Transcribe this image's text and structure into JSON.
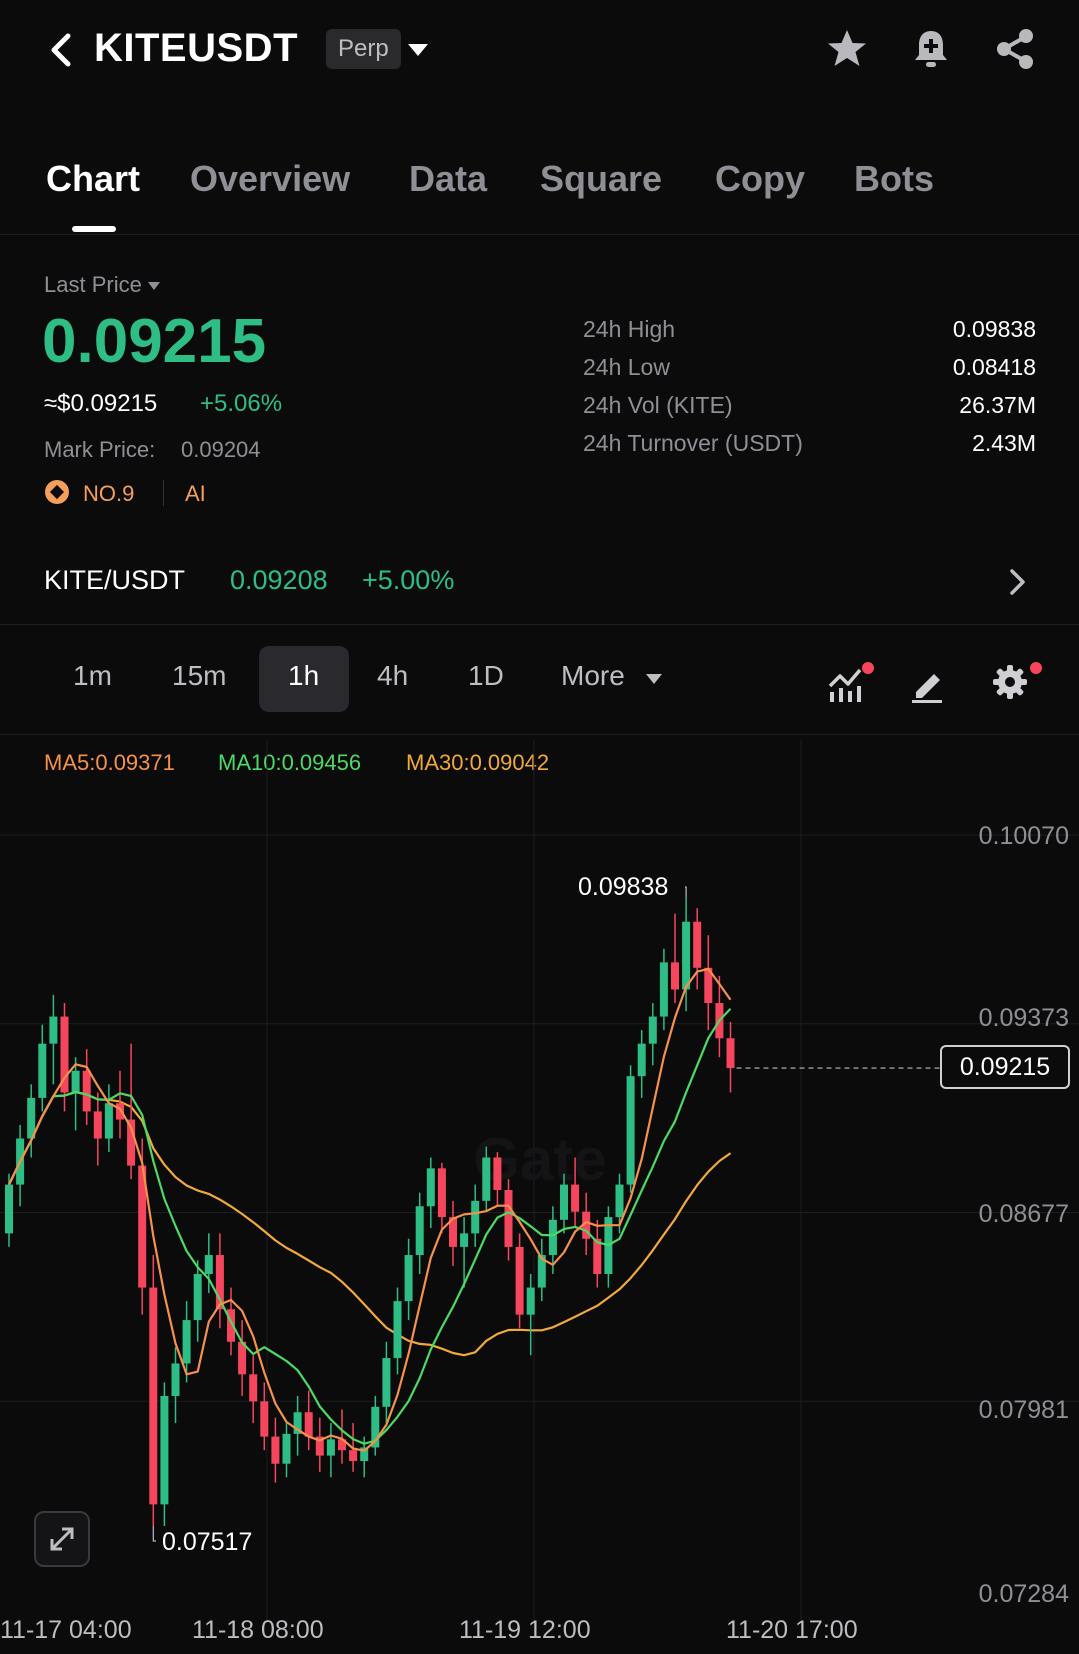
{
  "header": {
    "symbol": "KITEUSDT",
    "contract_type": "Perp",
    "icons": [
      "back-icon",
      "dropdown-icon",
      "star-icon",
      "bell-plus-icon",
      "share-icon"
    ]
  },
  "tabs": [
    "Chart",
    "Overview",
    "Data",
    "Square",
    "Copy",
    "Bots"
  ],
  "active_tab": "Chart",
  "price": {
    "label": "Last Price",
    "last": "0.09215",
    "usd_equiv": "≈$0.09215",
    "change_pct": "+5.06%",
    "mark_label": "Mark Price:",
    "mark_value": "0.09204",
    "rank": "NO.9",
    "tag": "AI"
  },
  "stats": [
    {
      "label": "24h High",
      "value": "0.09838"
    },
    {
      "label": "24h Low",
      "value": "0.08418"
    },
    {
      "label": "24h Vol (KITE)",
      "value": "26.37M"
    },
    {
      "label": "24h Turnover (USDT)",
      "value": "2.43M"
    }
  ],
  "spot": {
    "pair": "KITE/USDT",
    "price": "0.09208",
    "change": "+5.00%"
  },
  "intervals": [
    "1m",
    "15m",
    "1h",
    "4h",
    "1D",
    "More"
  ],
  "active_interval": "1h",
  "ma_legend": {
    "ma5": "MA5:0.09371",
    "ma10": "MA10:0.09456",
    "ma30": "MA30:0.09042"
  },
  "colors": {
    "up": "#2ebd85",
    "down": "#f6465d",
    "ma5": "#f5914a",
    "ma10": "#4cd964",
    "ma30": "#f2a93b"
  },
  "chart_data": {
    "type": "candlestick",
    "y_ticks": [
      "0.10070",
      "0.09373",
      "0.08677",
      "0.07981",
      "0.07284"
    ],
    "ylim": [
      0.07284,
      0.1007
    ],
    "x_ticks": [
      "11-17 04:00",
      "11-18 08:00",
      "11-19 12:00",
      "11-20 17:00"
    ],
    "high_label": "0.09838",
    "low_label": "0.07517",
    "current_price": "0.09215",
    "candles": [
      [
        0.086,
        0.0882,
        0.0855,
        0.0878
      ],
      [
        0.0878,
        0.09,
        0.087,
        0.0895
      ],
      [
        0.0895,
        0.0915,
        0.0888,
        0.091
      ],
      [
        0.091,
        0.0937,
        0.0905,
        0.093
      ],
      [
        0.093,
        0.0948,
        0.0915,
        0.094
      ],
      [
        0.094,
        0.0945,
        0.0905,
        0.0912
      ],
      [
        0.0912,
        0.0925,
        0.0898,
        0.092
      ],
      [
        0.092,
        0.0928,
        0.09,
        0.0905
      ],
      [
        0.0905,
        0.0912,
        0.0885,
        0.0895
      ],
      [
        0.0895,
        0.0915,
        0.089,
        0.0908
      ],
      [
        0.0908,
        0.092,
        0.0895,
        0.0902
      ],
      [
        0.0902,
        0.093,
        0.088,
        0.0885
      ],
      [
        0.0885,
        0.0895,
        0.083,
        0.084
      ],
      [
        0.084,
        0.0852,
        0.0752,
        0.076
      ],
      [
        0.076,
        0.0805,
        0.0752,
        0.08
      ],
      [
        0.08,
        0.0818,
        0.079,
        0.0812
      ],
      [
        0.0812,
        0.0835,
        0.0805,
        0.0828
      ],
      [
        0.0828,
        0.085,
        0.082,
        0.0845
      ],
      [
        0.0845,
        0.086,
        0.0838,
        0.0852
      ],
      [
        0.0852,
        0.086,
        0.0825,
        0.0832
      ],
      [
        0.0832,
        0.084,
        0.0815,
        0.082
      ],
      [
        0.082,
        0.0828,
        0.08,
        0.0808
      ],
      [
        0.0808,
        0.0815,
        0.079,
        0.0798
      ],
      [
        0.0798,
        0.0805,
        0.078,
        0.0785
      ],
      [
        0.0785,
        0.0792,
        0.0768,
        0.0775
      ],
      [
        0.0775,
        0.079,
        0.077,
        0.0786
      ],
      [
        0.0786,
        0.08,
        0.0778,
        0.0794
      ],
      [
        0.0794,
        0.0802,
        0.078,
        0.0785
      ],
      [
        0.0785,
        0.0792,
        0.0772,
        0.0778
      ],
      [
        0.0778,
        0.079,
        0.077,
        0.0784
      ],
      [
        0.0784,
        0.0795,
        0.0775,
        0.078
      ],
      [
        0.078,
        0.079,
        0.0772,
        0.0776
      ],
      [
        0.0776,
        0.0785,
        0.077,
        0.0781
      ],
      [
        0.0781,
        0.08,
        0.0778,
        0.0796
      ],
      [
        0.0796,
        0.082,
        0.079,
        0.0814
      ],
      [
        0.0814,
        0.084,
        0.0808,
        0.0835
      ],
      [
        0.0835,
        0.0858,
        0.0828,
        0.0852
      ],
      [
        0.0852,
        0.0875,
        0.0845,
        0.087
      ],
      [
        0.087,
        0.0888,
        0.0862,
        0.0884
      ],
      [
        0.0884,
        0.0886,
        0.086,
        0.0866
      ],
      [
        0.0866,
        0.0872,
        0.0848,
        0.0855
      ],
      [
        0.0855,
        0.0866,
        0.084,
        0.086
      ],
      [
        0.086,
        0.0878,
        0.0855,
        0.0872
      ],
      [
        0.0872,
        0.0892,
        0.0868,
        0.0888
      ],
      [
        0.0888,
        0.089,
        0.087,
        0.0876
      ],
      [
        0.0876,
        0.088,
        0.085,
        0.0855
      ],
      [
        0.0855,
        0.086,
        0.0825,
        0.083
      ],
      [
        0.083,
        0.0845,
        0.0815,
        0.084
      ],
      [
        0.084,
        0.0858,
        0.0835,
        0.0852
      ],
      [
        0.0852,
        0.087,
        0.0845,
        0.0865
      ],
      [
        0.0865,
        0.0882,
        0.086,
        0.0878
      ],
      [
        0.0878,
        0.0888,
        0.0862,
        0.0868
      ],
      [
        0.0868,
        0.0875,
        0.0852,
        0.0858
      ],
      [
        0.0858,
        0.0865,
        0.084,
        0.0845
      ],
      [
        0.0845,
        0.087,
        0.084,
        0.0866
      ],
      [
        0.0866,
        0.0882,
        0.086,
        0.0878
      ],
      [
        0.0878,
        0.0922,
        0.0875,
        0.0918
      ],
      [
        0.0918,
        0.0935,
        0.091,
        0.093
      ],
      [
        0.093,
        0.0945,
        0.0922,
        0.094
      ],
      [
        0.094,
        0.0965,
        0.0935,
        0.096
      ],
      [
        0.096,
        0.0978,
        0.0945,
        0.095
      ],
      [
        0.095,
        0.0984,
        0.0942,
        0.0975
      ],
      [
        0.0975,
        0.098,
        0.095,
        0.0958
      ],
      [
        0.0958,
        0.097,
        0.0935,
        0.0945
      ],
      [
        0.0945,
        0.0955,
        0.0925,
        0.0932
      ],
      [
        0.0932,
        0.0938,
        0.0912,
        0.0921
      ]
    ]
  }
}
